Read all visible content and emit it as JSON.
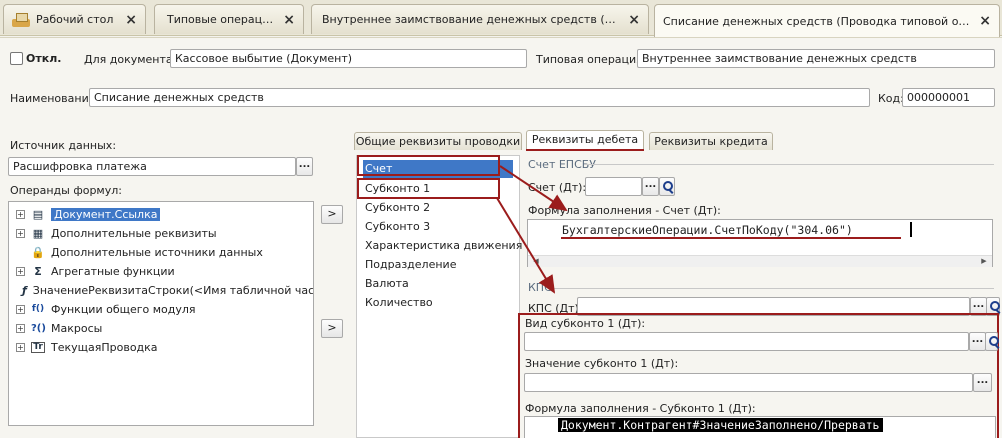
{
  "tabs": [
    {
      "label": "Рабочий стол"
    },
    {
      "label": "Типовые операции"
    },
    {
      "label": "Внутреннее заимствование денежных средств (Типовая ..."
    },
    {
      "label": "Списание денежных средств (Проводка типовой операции)"
    }
  ],
  "close_glyph": "×",
  "header": {
    "disabled_label": "Откл.",
    "for_doc_label": "Для документа:",
    "for_doc_value": "Кассовое выбытие (Документ)",
    "typical_op_label": "Типовая операция:",
    "typical_op_value": "Внутреннее заимствование денежных средств",
    "name_label": "Наименование:",
    "name_value": "Списание денежных средств",
    "code_label": "Код:",
    "code_value": "000000001"
  },
  "left": {
    "source_label": "Источник данных:",
    "source_value": "Расшифровка платежа",
    "operands_label": "Операнды формул:",
    "dots": "...",
    "arrow_btn": ">",
    "tree": [
      {
        "label": "Документ.Ссылка",
        "icon": "▤",
        "expandable": true,
        "selected": true
      },
      {
        "label": "Дополнительные реквизиты",
        "icon": "▦",
        "expandable": true,
        "selected": false
      },
      {
        "label": "Дополнительные источники данных",
        "icon": "🔒",
        "expandable": false,
        "selected": false
      },
      {
        "label": "Агрегатные функции",
        "icon": "Σ",
        "expandable": true,
        "selected": false
      },
      {
        "label": "ЗначениеРеквизитаСтроки(<Имя табличной части",
        "icon": "ƒ",
        "expandable": false,
        "selected": false
      },
      {
        "label": "Функции общего модуля",
        "icon": "f()",
        "expandable": true,
        "selected": false
      },
      {
        "label": "Макросы",
        "icon": "?()",
        "expandable": true,
        "selected": false
      },
      {
        "label": "ТекущаяПроводка",
        "icon": "Tr",
        "expandable": true,
        "selected": false
      }
    ]
  },
  "inner_tabs": [
    {
      "label": "Общие реквизиты проводки"
    },
    {
      "label": "Реквизиты дебета"
    },
    {
      "label": "Реквизиты кредита"
    }
  ],
  "debit_list": [
    {
      "label": "Счет"
    },
    {
      "label": "Субконто 1"
    },
    {
      "label": "Субконто 2"
    },
    {
      "label": "Субконто 3"
    },
    {
      "label": "Характеристика движения"
    },
    {
      "label": "Подразделение"
    },
    {
      "label": "Валюта"
    },
    {
      "label": "Количество"
    }
  ],
  "right": {
    "group_epsbu": "Счет ЕПСБУ",
    "account_label": "Счет (Дт):",
    "formula_account_label": "Формула заполнения - Счет (Дт):",
    "formula_account_code": "БухгалтерскиеОперации.СчетПоКоду(\"304.06\")",
    "group_kps": "КПС",
    "kps_label": "КПС (Дт):",
    "sub_kind_label": "Вид субконто 1 (Дт):",
    "sub_value_label": "Значение субконто 1 (Дт):",
    "formula_sub_label": "Формула заполнения - Субконто 1 (Дт):",
    "formula_sub_code": "Документ.Контрагент#ЗначениеЗаполнено/Прервать",
    "dots": "..."
  },
  "colors": {
    "selection": "#3f78c7",
    "annotation": "#9b1c1c"
  }
}
